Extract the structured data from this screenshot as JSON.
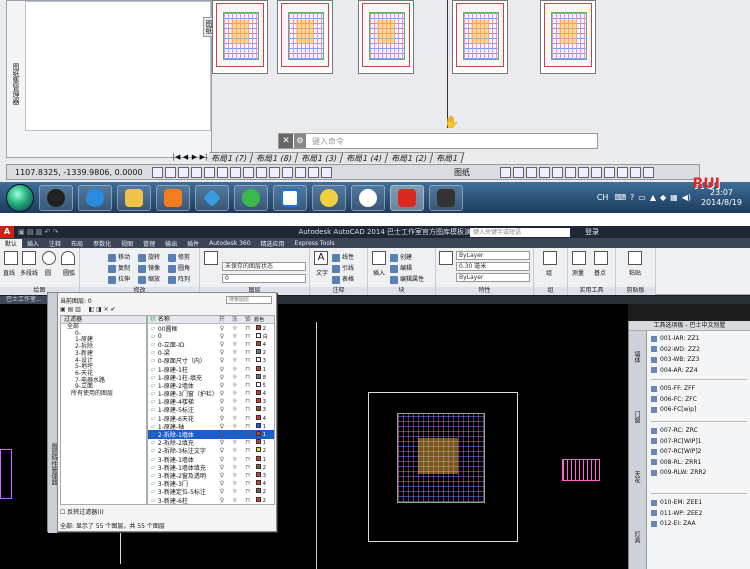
{
  "top": {
    "sheet_panel": {
      "vertical_label": "图纸集管理器",
      "tab_label": "图纸"
    },
    "command_line": {
      "close_symbol": "✕",
      "tool_symbol": "🔧",
      "placeholder": "键入命令"
    },
    "model_paper_label": "图纸",
    "layout_tabs": [
      "布局1 (7)",
      "布局1 (8)",
      "布局1 (3)",
      "布局1 (4)",
      "布局1 (2)",
      "布局1"
    ],
    "layout_nav": [
      "|◀",
      "◀",
      "▶",
      "▶|"
    ],
    "coordinates": "1107.8325, -1339.9806, 0.0000",
    "tray": {
      "lang": "CH",
      "time": "23:07",
      "date": "2014/8/19"
    },
    "watermark": "RUI"
  },
  "bottom": {
    "title": "Autodesk AutoCAD 2014   巴士工作室官方图库模板演示(开始文档).dwg",
    "search_placeholder": "键入关键字或短语",
    "user": "登录",
    "ribbon_tabs": [
      "默认",
      "插入",
      "注释",
      "布局",
      "参数化",
      "视图",
      "管理",
      "输出",
      "插件",
      "Autodesk 360",
      "精选应用",
      "Express Tools"
    ],
    "ribbon": {
      "draw_group": "绘图",
      "modify_group": "修改",
      "layer_group": "图层",
      "annotation_group": "注释",
      "block_group": "块",
      "properties_group": "特性",
      "groups_group": "组",
      "utilities_group": "实用工具",
      "clipboard_group": "剪贴板",
      "draw_buttons": [
        "直线",
        "多段线",
        "圆",
        "圆弧"
      ],
      "modify_buttons": [
        "移动",
        "旋转",
        "修剪",
        "复制",
        "镜像",
        "圆角",
        "拉伸",
        "缩放",
        "阵列"
      ],
      "layer_state": "未保存的图层状态",
      "current_layer": "0",
      "annotation_buttons": [
        "文字",
        "线性",
        "引线",
        "表格"
      ],
      "block_buttons": [
        "插入",
        "创建",
        "编辑",
        "编辑属性"
      ],
      "bylayer_color": "ByLayer",
      "lineweight": "0.30 毫米",
      "linetype": "ByLayer",
      "groups_button": "组",
      "measure_button": "测量",
      "paste_button": "粘贴",
      "base_button": "基点"
    },
    "file_tab": "巴士工作室...",
    "layer_manager": {
      "current_layer": "当前图层: 0",
      "search_placeholder": "搜索图层",
      "filter_header": "过滤器",
      "tree": [
        {
          "label": "全部",
          "level": 0
        },
        {
          "label": "0-",
          "level": 1
        },
        {
          "label": "1-原建",
          "level": 1
        },
        {
          "label": "2-拆除",
          "level": 1
        },
        {
          "label": "3-新建",
          "level": 1
        },
        {
          "label": "4-设计",
          "level": 1
        },
        {
          "label": "5-地坪",
          "level": 1
        },
        {
          "label": "6-天花",
          "level": 1
        },
        {
          "label": "7-电器水路",
          "level": 1
        },
        {
          "label": "9-立面",
          "level": 1
        },
        {
          "label": "所有使用的图层",
          "level": 2
        }
      ],
      "columns": {
        "status": "状",
        "name": "名称",
        "on": "开",
        "freeze": "冻",
        "lock": "锁",
        "color": "颜色"
      },
      "layers": [
        {
          "name": "00圆框",
          "color": "#d63a2a",
          "cnum": "2"
        },
        {
          "name": "0",
          "color": "#ffffff",
          "cnum": "白"
        },
        {
          "name": "0-立面-ID",
          "color": "#d63a2a",
          "cnum": "4"
        },
        {
          "name": "0-梁",
          "color": "#777777",
          "cnum": "2"
        },
        {
          "name": "0-原面尺寸（内）",
          "color": "#ffffff",
          "cnum": "3"
        },
        {
          "name": "1-原建-1柱",
          "color": "#d63a2a",
          "cnum": "1"
        },
        {
          "name": "1-原建-1柱-填充",
          "color": "#777777",
          "cnum": "8"
        },
        {
          "name": "1-原建-2墙体",
          "color": "#ffffff",
          "cnum": "5"
        },
        {
          "name": "1-原建-3门窗（护栏）",
          "color": "#d63a2a",
          "cnum": "4"
        },
        {
          "name": "1-原建-4楼梯",
          "color": "#d63a2a",
          "cnum": "3"
        },
        {
          "name": "1-原建-5标注",
          "color": "#8a5a2a",
          "cnum": "3"
        },
        {
          "name": "1-原建-6天花",
          "color": "#d63a2a",
          "cnum": "4"
        },
        {
          "name": "1-原建-轴",
          "color": "#1e5bd6",
          "cnum": "1"
        },
        {
          "name": "2-拆除-1墙体",
          "color": "#d63a2a",
          "cnum": "1",
          "selected": true
        },
        {
          "name": "2-拆除-2填充",
          "color": "#d63a2a",
          "cnum": "1"
        },
        {
          "name": "2-拆除-3标注文字",
          "color": "#f2d84a",
          "cnum": "2"
        },
        {
          "name": "3-新建-1墙体",
          "color": "#d63a2a",
          "cnum": "1"
        },
        {
          "name": "3-新建-1墙体填充",
          "color": "#8a5a2a",
          "cnum": "2"
        },
        {
          "name": "3-新建-2窗及透明",
          "color": "#d63a2a",
          "cnum": "3"
        },
        {
          "name": "3-新建-3门",
          "color": "#d63a2a",
          "cnum": "4"
        },
        {
          "name": "3-新建定位-5标注",
          "color": "#8a5a2a",
          "cnum": "2"
        },
        {
          "name": "3-新建-6柱",
          "color": "#d63a2a",
          "cnum": "2"
        }
      ],
      "invert_filter": "反转过滤器(I)",
      "footer": "全部: 显示了 55 个图层，共 55 个图层",
      "side_label": "图层特性管理器"
    },
    "palette": {
      "title": "工具选项板 - 巴士中文别墅",
      "tabs": [
        "墙体",
        "门窗",
        "天花",
        "灯具"
      ],
      "items_group1": [
        "001-IAR: ZZ1",
        "002-WD: ZZ2",
        "003-WB: ZZ3",
        "004-AR: ZZ4"
      ],
      "items_group2": [
        "005-FF: ZFF",
        "006-FC: ZFC",
        "006-FC[wip]"
      ],
      "items_group3": [
        "007-RC: ZRC",
        "007-RC[WIP]1",
        "007-RC[WIP]2",
        "008-RL: ZRR1",
        "009-RLW: ZRR2"
      ],
      "items_group4": [
        "010-EM: ZEE1",
        "011-WP: ZEE2",
        "012-EI: ZAA"
      ]
    }
  }
}
